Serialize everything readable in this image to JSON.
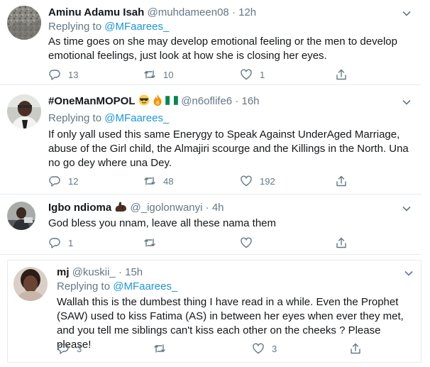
{
  "tweets": [
    {
      "name": "Aminu Adamu Isah",
      "handle": "@muhdameen08",
      "time": "12h",
      "reply_prefix": "Replying to",
      "reply_to": "@MFaarees_",
      "text": "As time goes on she may develop emotional feeling or the men to develop emotional feelings, just look at how she is closing her eyes.",
      "replies": "13",
      "retweets": "10",
      "likes": "1"
    },
    {
      "name": "#OneManMOPOL",
      "handle": "@n6oflife6",
      "time": "16h",
      "reply_prefix": "Replying to",
      "reply_to": "@MFaarees_",
      "text": "If only yall used this same Enerygy to Speak Against UnderAged Marriage, abuse of the Girl child, the Almajiri scourge and the Killings in the North. Una no go dey where una Dey.",
      "replies": "12",
      "retweets": "48",
      "likes": "192"
    },
    {
      "name": "Igbo ndioma",
      "handle": "@_igolonwanyi",
      "time": "4h",
      "text": "God bless you nnam, leave all these nama them",
      "replies": "1",
      "retweets": "",
      "likes": ""
    },
    {
      "name": "mj",
      "handle": "@kuskii_",
      "time": "15h",
      "reply_prefix": "Replying to",
      "reply_to": "@MFaarees_",
      "text": "Wallah this is the dumbest thing I have read in a while. Even the Prophet (SAW) used to kiss Fatima (AS) in between her eyes when ever they met, and you tell me siblings can't kiss each other on the cheeks ? Please please!",
      "replies": "3",
      "retweets": "",
      "likes": "3"
    }
  ],
  "separator": "·",
  "icons": {
    "reply": "reply-icon",
    "retweet": "retweet-icon",
    "like": "heart-icon",
    "share": "share-icon",
    "more": "chevron-down-icon"
  },
  "colors": {
    "link": "#1b95e0",
    "muted": "#657786",
    "text": "#14171a",
    "border": "#e6ecf0"
  }
}
